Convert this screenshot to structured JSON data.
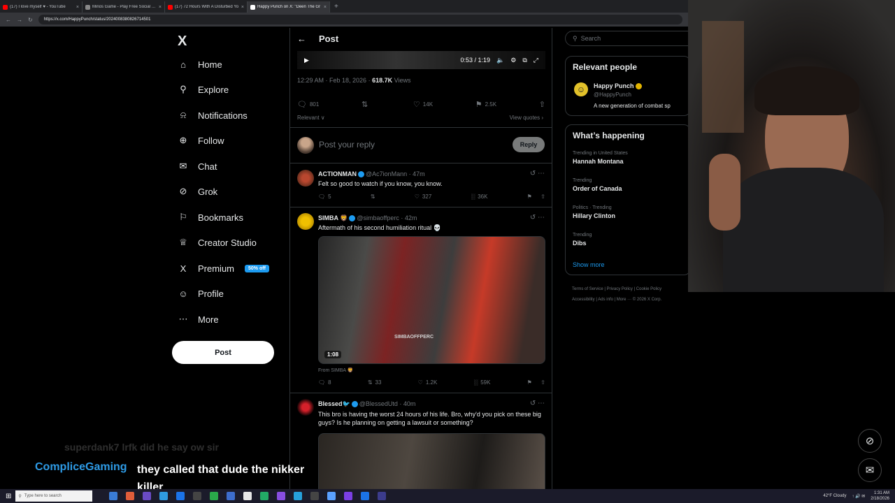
{
  "browser": {
    "tabs": [
      {
        "title": "(17) I love myself ♥ - YouTube",
        "active": false,
        "favicon_color": "#ff0000"
      },
      {
        "title": "Minos Game - Play Free Social Ca",
        "active": false,
        "favicon_color": "#888888"
      },
      {
        "title": "(17) 72 Hours With A Disturbed Yo",
        "active": false,
        "favicon_color": "#ff0000"
      },
      {
        "title": "Happy Punch on X: \"Deen The Gr",
        "active": true,
        "favicon_color": "#ffffff"
      }
    ],
    "url": "https://x.com/HappyPunch/status/2024008380826714501"
  },
  "nav": {
    "logo": "X",
    "items": [
      {
        "label": "Home",
        "icon": "home-icon",
        "glyph": "⌂"
      },
      {
        "label": "Explore",
        "icon": "search-icon",
        "glyph": "⚲"
      },
      {
        "label": "Notifications",
        "icon": "bell-icon",
        "glyph": "⍾"
      },
      {
        "label": "Follow",
        "icon": "follow-icon",
        "glyph": "⊕"
      },
      {
        "label": "Chat",
        "icon": "mail-icon",
        "glyph": "✉"
      },
      {
        "label": "Grok",
        "icon": "grok-icon",
        "glyph": "⊘"
      },
      {
        "label": "Bookmarks",
        "icon": "bookmark-icon",
        "glyph": "⚐"
      },
      {
        "label": "Creator Studio",
        "icon": "creator-studio-icon",
        "glyph": "♕"
      },
      {
        "label": "Premium",
        "icon": "x-premium-icon",
        "glyph": "X"
      },
      {
        "label": "Profile",
        "icon": "profile-icon",
        "glyph": "☺"
      },
      {
        "label": "More",
        "icon": "more-icon",
        "glyph": "⋯"
      }
    ],
    "premium_badge": "50% off",
    "post_button": "Post"
  },
  "main": {
    "header_title": "Post",
    "player": {
      "time": "0:53 / 1:19"
    },
    "post_meta": {
      "time": "12:29 AM · Feb 18, 2026 · ",
      "views": "618.7K",
      "views_label": " Views"
    },
    "actions": {
      "replies": "801",
      "reposts": "",
      "likes": "14K",
      "bookmarks": "2.5K"
    },
    "sort_label": "Relevant ∨",
    "view_quotes": "View quotes ›",
    "reply_placeholder": "Post your reply",
    "reply_button": "Reply",
    "tweets": [
      {
        "name": "ACTIONMAN",
        "handle": "@Ac7ionMann · 47m",
        "text": "Felt so good to watch if you know, you know.",
        "replies": "5",
        "reposts": "",
        "likes": "327",
        "views": "36K"
      },
      {
        "name": "SIMBA 🦁",
        "handle": "@simbaoffperc · 42m",
        "text": "Aftermath of his second humiliation ritual 💀",
        "video_duration": "1:08",
        "watermark": "SIMBAOFFPERC",
        "from": "From SIMBA 🦁",
        "replies": "8",
        "reposts": "33",
        "likes": "1.2K",
        "views": "59K"
      },
      {
        "name": "Blessed🐦",
        "handle": "@BlessedUtd · 40m",
        "text": "This bro is having the worst 24 hours of his life. Bro, why'd you pick on these big guys? Is he planning on getting a lawsuit or something?"
      }
    ]
  },
  "sidebar": {
    "search_placeholder": "Search",
    "relevant_title": "Relevant people",
    "person": {
      "name": "Happy Punch",
      "handle": "@HappyPunch",
      "bio": "A new generation of combat sp"
    },
    "happening_title": "What’s happening",
    "trends": [
      {
        "context": "Trending in United States",
        "name": "Hannah Montana"
      },
      {
        "context": "Trending",
        "name": "Order of Canada"
      },
      {
        "context": "Politics · Trending",
        "name": "Hillary Clinton"
      },
      {
        "context": "Trending",
        "name": "Dibs"
      }
    ],
    "show_more": "Show more",
    "footer_line1": "Terms of Service  |  Privacy Policy  |  Cookie Policy",
    "footer_line2": "Accessibility  |  Ads info  |  More ···  © 2026 X Corp."
  },
  "chat": {
    "faded": "superdank7  lrfk did he say ow sir",
    "user": "CompliceGaming",
    "message": "they called that dude the nikker killer"
  },
  "taskbar": {
    "search_placeholder": "Type here to search",
    "weather": "42°F  Cloudy",
    "time": "1:31 AM",
    "date": "2/18/2026",
    "app_colors": [
      "#3a7bd5",
      "#e05d3a",
      "#6a4bc4",
      "#2f9be0",
      "#1b73e8",
      "#444444",
      "#2aa84a",
      "#3d6dcc",
      "#e6e6e6",
      "#22aa66",
      "#884ee0",
      "#26a0da",
      "#444444",
      "#5aa0ff",
      "#7b3fe4",
      "#1b73e8",
      "#3c3c8c"
    ]
  },
  "colors": {
    "accent": "#1d9bf0",
    "chat_user": "#2e9be6",
    "background": "#000000"
  }
}
